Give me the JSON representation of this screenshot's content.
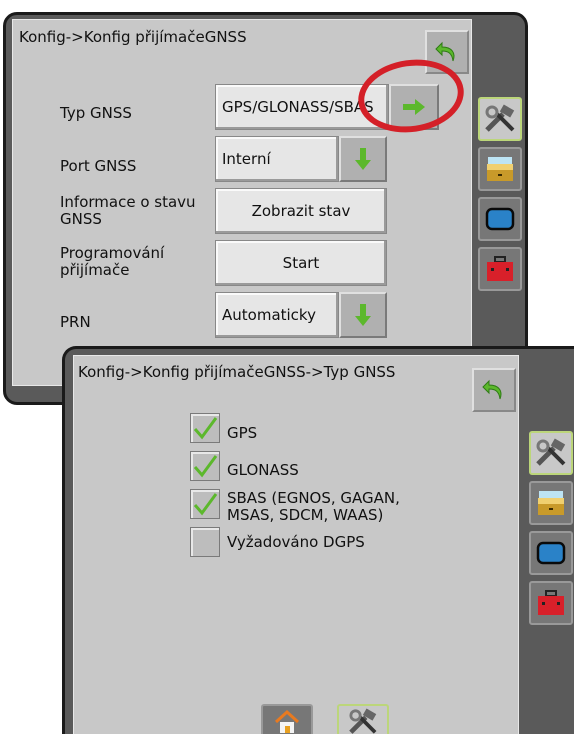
{
  "screen1": {
    "title": "Konfig->Konfig přijímačeGNSS",
    "rows": [
      {
        "label": "Typ GNSS",
        "value": "GPS/GLONASS/SBAS"
      },
      {
        "label": "Port GNSS",
        "value": "Interní"
      },
      {
        "label": "Informace o stavu GNSS",
        "value": "Zobrazit stav"
      },
      {
        "label": "Programování přijímače",
        "value": "Start"
      },
      {
        "label": "PRN",
        "value": "Automaticky"
      }
    ]
  },
  "screen2": {
    "title": "Konfig->Konfig přijímačeGNSS->Typ GNSS",
    "options": [
      {
        "label": "GPS",
        "checked": true
      },
      {
        "label": "GLONASS",
        "checked": true
      },
      {
        "label": "SBAS (EGNOS, GAGAN, MSAS, SDCM, WAAS)",
        "checked": true
      },
      {
        "label": "Vyžadováno DGPS",
        "checked": false
      }
    ]
  },
  "side_tabs": [
    "tools-icon",
    "folder-icon",
    "monitor-icon",
    "toolbox-icon"
  ],
  "bottom_tabs": [
    "home-icon",
    "tools-icon"
  ],
  "colors": {
    "accent_green": "#5cb82c",
    "highlight_red": "#d42028"
  }
}
